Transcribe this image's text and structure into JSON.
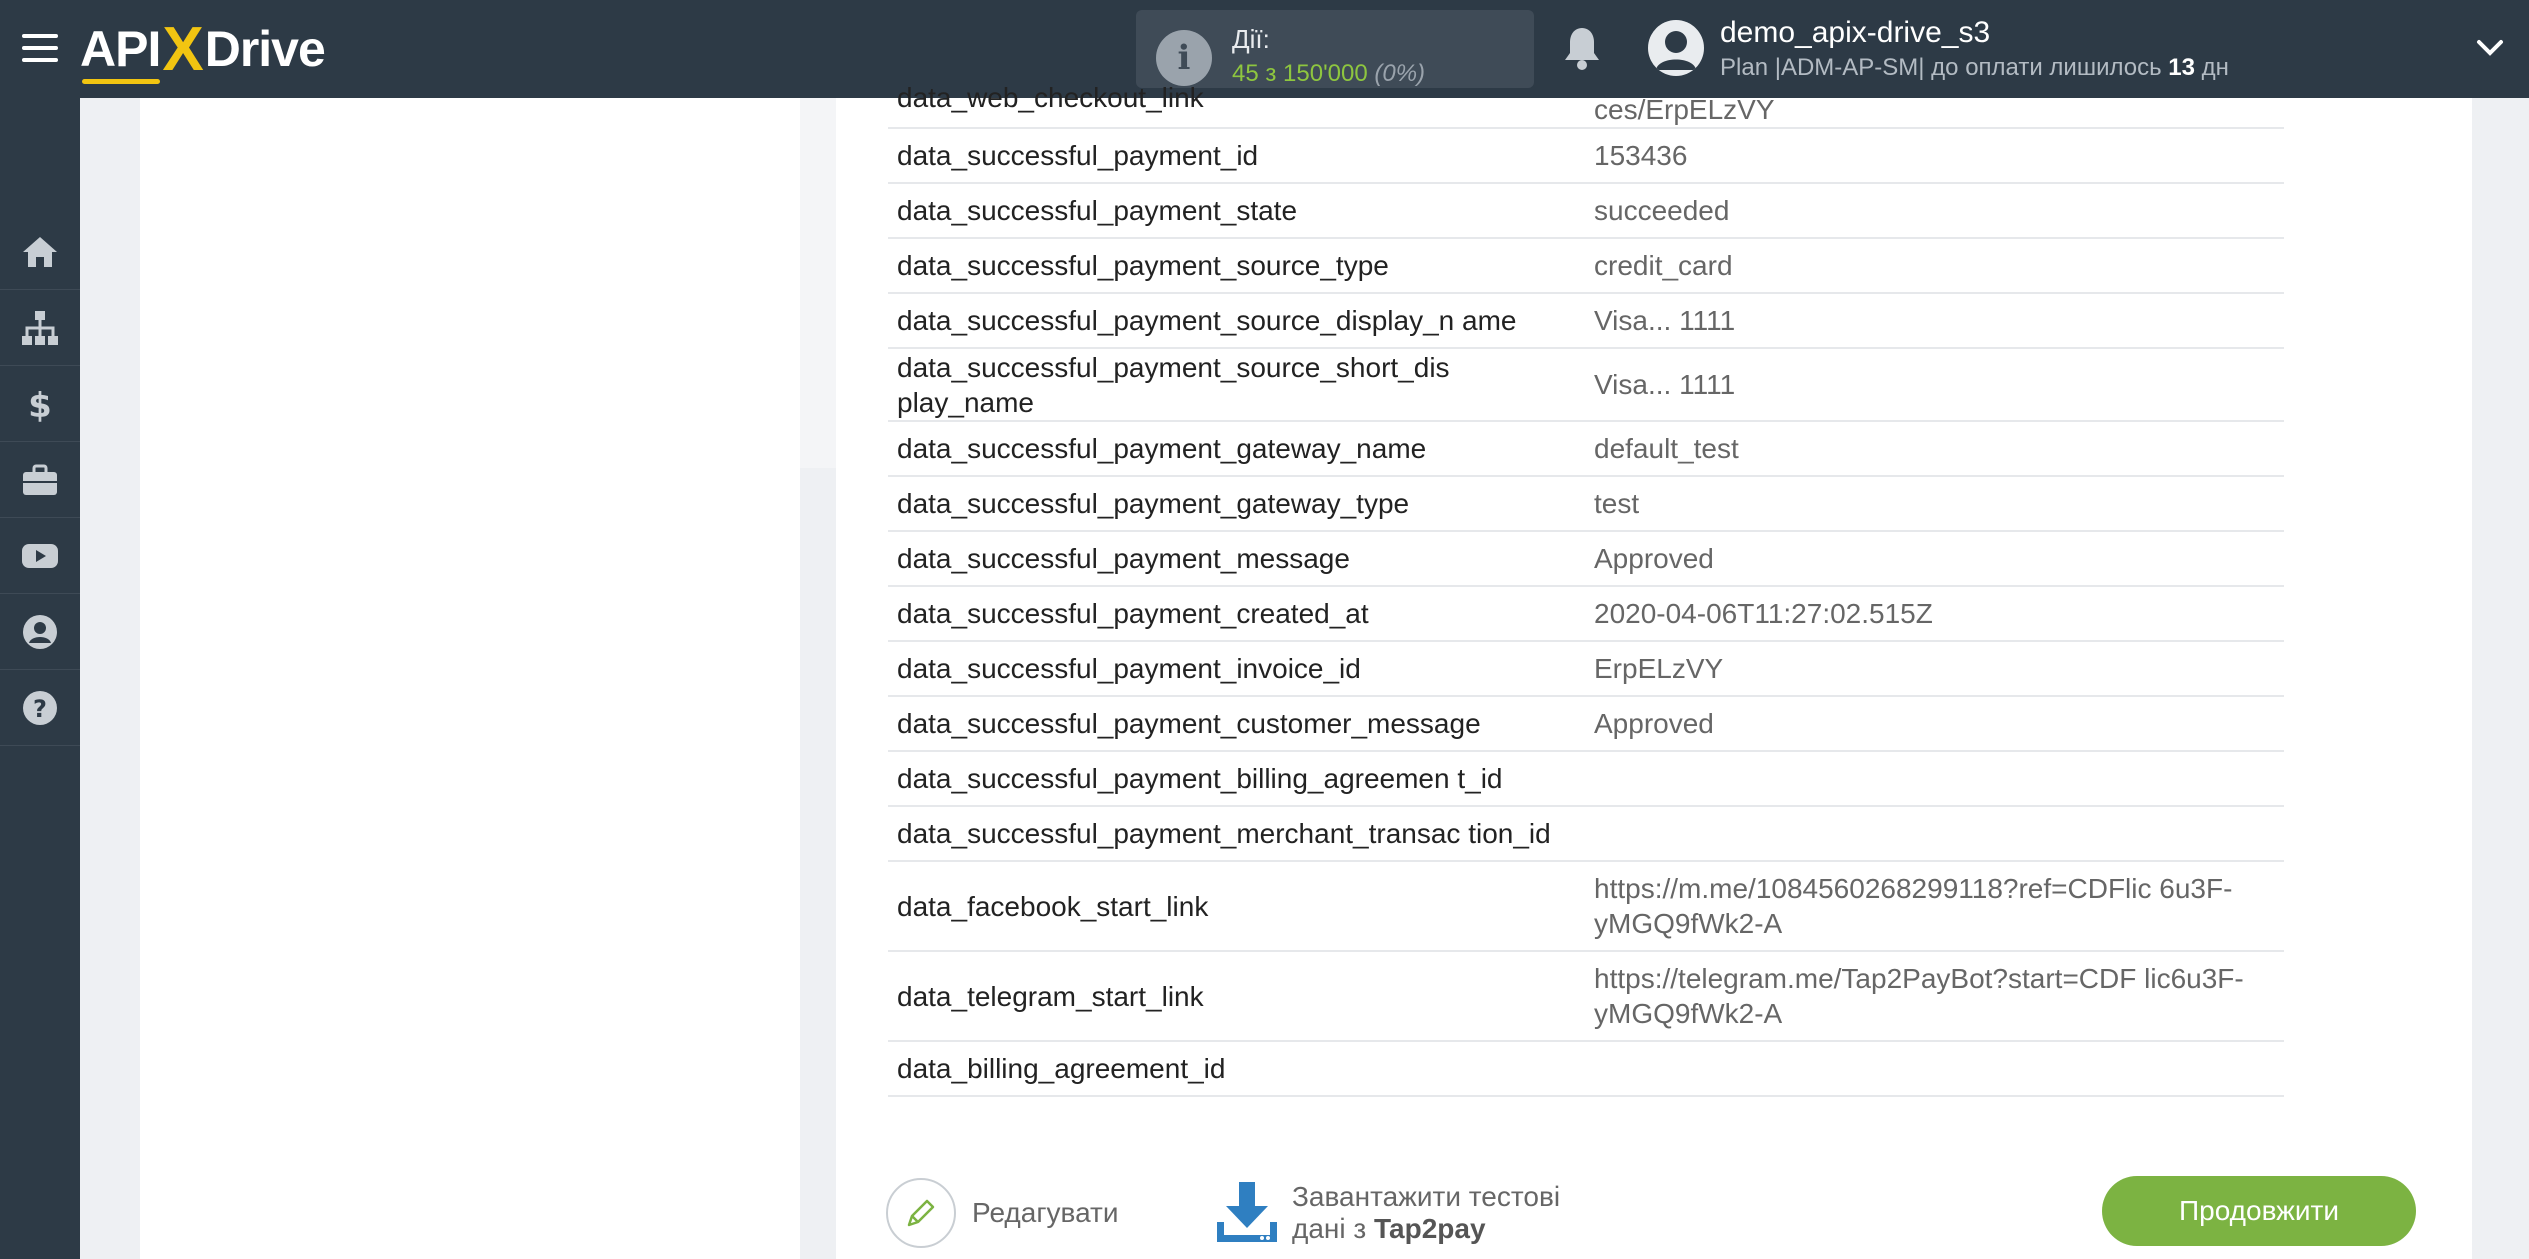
{
  "app": {
    "logo_api": "API",
    "logo_x": "X",
    "logo_drive": "Drive"
  },
  "header": {
    "actions_label": "Дії:",
    "actions_count": "45 з 150'000",
    "actions_percent": "(0%)",
    "user_name": "demo_apix-drive_s3",
    "plan_text": "Plan |ADM-AP-SM| до оплати лишилось",
    "plan_days": "13",
    "plan_days_unit": "дн"
  },
  "sidebar": {
    "items": [
      {
        "icon": "home-icon"
      },
      {
        "icon": "sitemap-icon"
      },
      {
        "icon": "dollar-icon"
      },
      {
        "icon": "briefcase-icon"
      },
      {
        "icon": "youtube-icon"
      },
      {
        "icon": "user-icon"
      },
      {
        "icon": "help-icon"
      }
    ]
  },
  "table": {
    "rows": [
      {
        "key": "data_web_checkout_link",
        "value": "ces/ErpELzVY"
      },
      {
        "key": "data_successful_payment_id",
        "value": "153436"
      },
      {
        "key": "data_successful_payment_state",
        "value": "succeeded"
      },
      {
        "key": "data_successful_payment_source_type",
        "value": "credit_card"
      },
      {
        "key": "data_successful_payment_source_display_n ame",
        "value": "Visa... 1111"
      },
      {
        "key": "data_successful_payment_source_short_dis play_name",
        "value": "Visa... 1111"
      },
      {
        "key": "data_successful_payment_gateway_name",
        "value": "default_test"
      },
      {
        "key": "data_successful_payment_gateway_type",
        "value": "test"
      },
      {
        "key": "data_successful_payment_message",
        "value": "Approved"
      },
      {
        "key": "data_successful_payment_created_at",
        "value": "2020-04-06T11:27:02.515Z"
      },
      {
        "key": "data_successful_payment_invoice_id",
        "value": "ErpELzVY"
      },
      {
        "key": "data_successful_payment_customer_message",
        "value": "Approved"
      },
      {
        "key": "data_successful_payment_billing_agreemen t_id",
        "value": ""
      },
      {
        "key": "data_successful_payment_merchant_transac tion_id",
        "value": ""
      },
      {
        "key": "data_facebook_start_link",
        "value": "https://m.me/1084560268299118?ref=CDFlic 6u3F-yMGQ9fWk2-A"
      },
      {
        "key": "data_telegram_start_link",
        "value": "https://telegram.me/Tap2PayBot?start=CDF lic6u3F-yMGQ9fWk2-A"
      },
      {
        "key": "data_billing_agreement_id",
        "value": ""
      }
    ]
  },
  "footer": {
    "edit_label": "Редагувати",
    "download_line1": "Завантажити тестові",
    "download_line2_prefix": "дані з",
    "download_source": "Tap2pay",
    "continue_label": "Продовжити"
  },
  "colors": {
    "topbar": "#2d3a46",
    "accent_green": "#7cb342",
    "logo_yellow": "#f2c511",
    "download_blue": "#2f7fc1"
  }
}
